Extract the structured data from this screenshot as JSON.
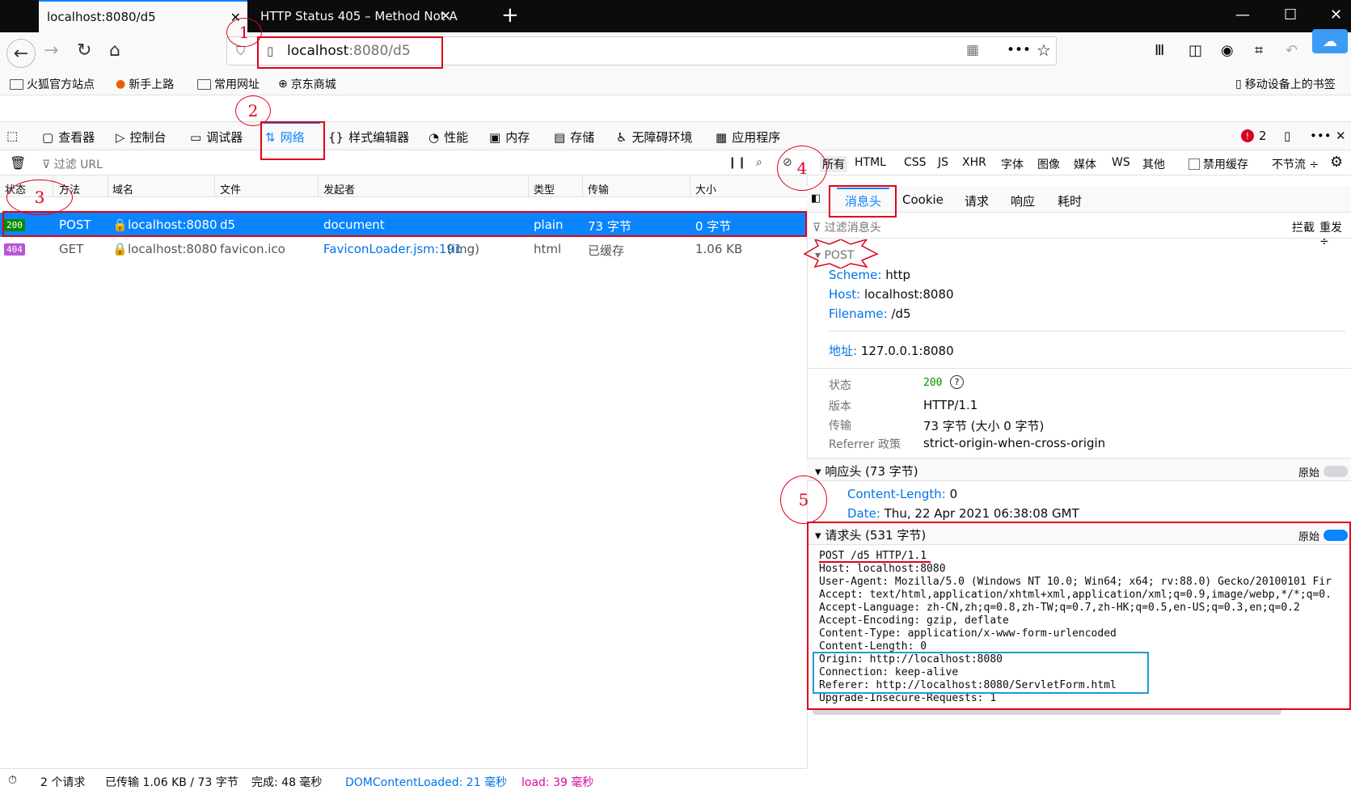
{
  "browser": {
    "tabs": [
      {
        "label": "localhost:8080/d5"
      },
      {
        "label": "HTTP Status 405 – Method Not A"
      }
    ],
    "url_host": "localhost",
    "url_rest": ":8080/d5",
    "bookmarks": [
      {
        "label": "火狐官方站点"
      },
      {
        "label": "新手上路"
      },
      {
        "label": "常用网址"
      },
      {
        "label": "京东商城"
      }
    ],
    "mobile_bookmarks": "移动设备上的书签"
  },
  "devtools": {
    "tabs": [
      {
        "label": "查看器"
      },
      {
        "label": "控制台"
      },
      {
        "label": "调试器"
      },
      {
        "label": "网络"
      },
      {
        "label": "样式编辑器"
      },
      {
        "label": "性能"
      },
      {
        "label": "内存"
      },
      {
        "label": "存储"
      },
      {
        "label": "无障碍环境"
      },
      {
        "label": "应用程序"
      }
    ],
    "error_count": "2",
    "filter_placeholder": "过滤 URL",
    "types": [
      "所有",
      "HTML",
      "CSS",
      "JS",
      "XHR",
      "字体",
      "图像",
      "媒体",
      "WS",
      "其他"
    ],
    "disable_cache": "禁用缓存",
    "throttle": "不节流 ÷"
  },
  "table": {
    "headers": [
      "状态",
      "方法",
      "域名",
      "文件",
      "发起者",
      "类型",
      "传输",
      "大小"
    ],
    "rows": [
      {
        "status": "200",
        "method": "POST",
        "domain": "localhost:8080",
        "file": "d5",
        "initiator": "document",
        "initiator_extra": "",
        "type": "plain",
        "transfer": "73 字节",
        "size": "0 字节"
      },
      {
        "status": "404",
        "method": "GET",
        "domain": "localhost:8080",
        "file": "favicon.ico",
        "initiator": "FaviconLoader.jsm:191",
        "initiator_extra": "(img)",
        "type": "html",
        "transfer": "已缓存",
        "size": "1.06 KB"
      }
    ]
  },
  "side": {
    "tabs": [
      "消息头",
      "Cookie",
      "请求",
      "响应",
      "耗时"
    ],
    "filter_placeholder": "过滤消息头",
    "block": "拦截",
    "resend": "重发 ÷",
    "method_heading": "POST",
    "scheme_key": "Scheme:",
    "scheme_val": "http",
    "host_key": "Host:",
    "host_val": "localhost:8080",
    "filename_key": "Filename:",
    "filename_val": "/d5",
    "address_key": "地址:",
    "address_val": "127.0.0.1:8080",
    "status_key": "状态",
    "status_val": "200",
    "version_key": "版本",
    "version_val": "HTTP/1.1",
    "transfer_key": "传输",
    "transfer_val": "73 字节 (大小 0 字节)",
    "referrer_key": "Referrer 政策",
    "referrer_val": "strict-origin-when-cross-origin",
    "resp_heading": "响应头 (73 字节)",
    "raw": "原始",
    "cl_key": "Content-Length:",
    "cl_val": "0",
    "date_key": "Date:",
    "date_val": "Thu, 22 Apr 2021 06:38:08 GMT",
    "req_heading": "请求头 (531 字节)",
    "raw_headers": "POST /d5 HTTP/1.1\nHost: localhost:8080\nUser-Agent: Mozilla/5.0 (Windows NT 10.0; Win64; x64; rv:88.0) Gecko/20100101 Fir\nAccept: text/html,application/xhtml+xml,application/xml;q=0.9,image/webp,*/*;q=0.\nAccept-Language: zh-CN,zh;q=0.8,zh-TW;q=0.7,zh-HK;q=0.5,en-US;q=0.3,en;q=0.2\nAccept-Encoding: gzip, deflate\nContent-Type: application/x-www-form-urlencoded\nContent-Length: 0\nOrigin: http://localhost:8080\nConnection: keep-alive\nReferer: http://localhost:8080/ServletForm.html\nUpgrade-Insecure-Requests: 1"
  },
  "statusbar": {
    "requests": "2 个请求",
    "transferred": "已传输 1.06 KB / 73 字节",
    "finish": "完成: 48 毫秒",
    "dcl": "DOMContentLoaded: 21 毫秒",
    "load": "load: 39 毫秒"
  },
  "annotations": [
    "1",
    "2",
    "3",
    "4",
    "5"
  ],
  "colors": {
    "accent": "#0a84ff",
    "annotation": "#e0001a",
    "highlight": "#1f9ad6"
  }
}
